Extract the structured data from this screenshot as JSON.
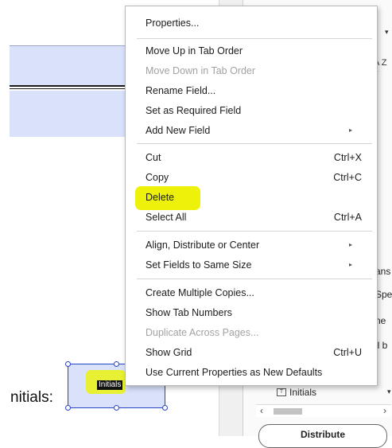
{
  "document": {
    "initials_label": "nitials:",
    "field_tag": "Initials"
  },
  "right_panel": {
    "side_texts": [
      "ans",
      "Spe",
      "ne",
      "ll b"
    ],
    "tree_item_label": "Initials",
    "tree_item_icon": "T",
    "distribute_label": "Distribute",
    "sort_icon": "A Z ▾",
    "caret_glyph": "▾",
    "scroll_left": "‹",
    "scroll_right": "›"
  },
  "context_menu": {
    "items": [
      {
        "label": "Properties...",
        "shortcut": "",
        "submenu": false,
        "disabled": false
      },
      {
        "label": "Move Up in Tab Order",
        "shortcut": "",
        "submenu": false,
        "disabled": false
      },
      {
        "label": "Move Down in Tab Order",
        "shortcut": "",
        "submenu": false,
        "disabled": true
      },
      {
        "label": "Rename Field...",
        "shortcut": "",
        "submenu": false,
        "disabled": false
      },
      {
        "label": "Set as Required Field",
        "shortcut": "",
        "submenu": false,
        "disabled": false
      },
      {
        "label": "Add New Field",
        "shortcut": "",
        "submenu": true,
        "disabled": false
      },
      {
        "label": "Cut",
        "shortcut": "Ctrl+X",
        "submenu": false,
        "disabled": false
      },
      {
        "label": "Copy",
        "shortcut": "Ctrl+C",
        "submenu": false,
        "disabled": false
      },
      {
        "label": "Delete",
        "shortcut": "",
        "submenu": false,
        "disabled": false
      },
      {
        "label": "Select All",
        "shortcut": "Ctrl+A",
        "submenu": false,
        "disabled": false
      },
      {
        "label": "Align, Distribute or Center",
        "shortcut": "",
        "submenu": true,
        "disabled": false
      },
      {
        "label": "Set Fields to Same Size",
        "shortcut": "",
        "submenu": true,
        "disabled": false
      },
      {
        "label": "Create Multiple Copies...",
        "shortcut": "",
        "submenu": false,
        "disabled": false
      },
      {
        "label": "Show Tab Numbers",
        "shortcut": "",
        "submenu": false,
        "disabled": false
      },
      {
        "label": "Duplicate Across Pages...",
        "shortcut": "",
        "submenu": false,
        "disabled": true
      },
      {
        "label": "Show Grid",
        "shortcut": "Ctrl+U",
        "submenu": false,
        "disabled": false
      },
      {
        "label": "Use Current Properties as New Defaults",
        "shortcut": "",
        "submenu": false,
        "disabled": false
      }
    ],
    "submenu_glyph": "▸"
  },
  "colors": {
    "highlight": "#eef20a",
    "field_fill": "#d9e1fb",
    "selection_border": "#2845c7",
    "disabled_text": "#a2a2a2"
  }
}
